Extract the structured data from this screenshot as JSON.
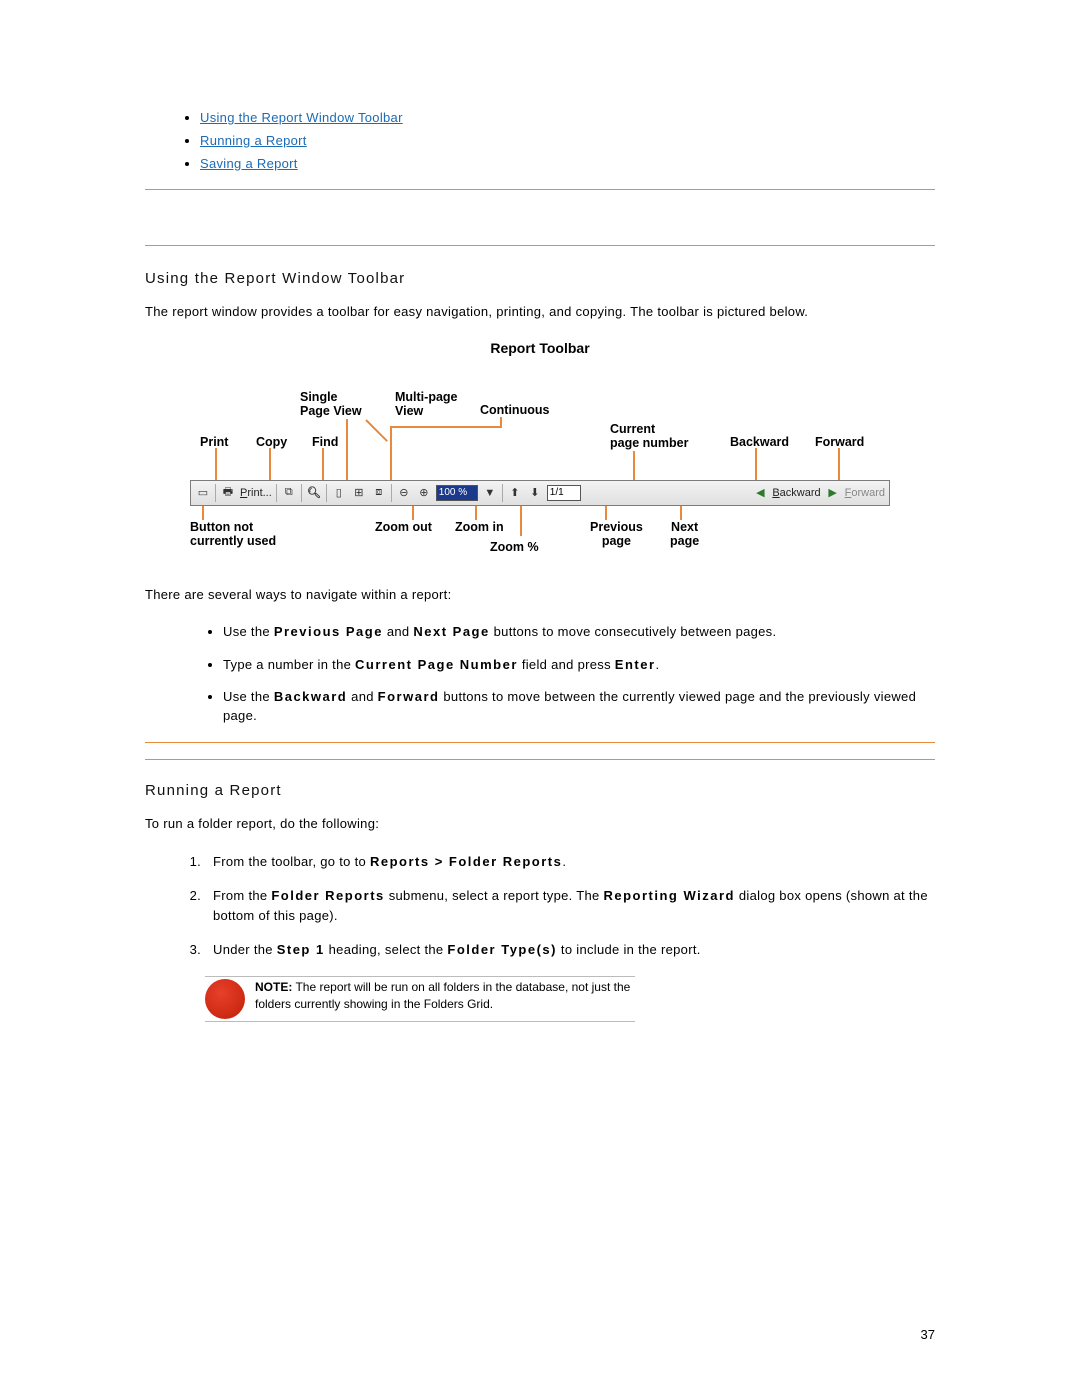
{
  "topLinks": {
    "l1": "Using the Report Window Toolbar",
    "l2": "Running a Report",
    "l3": "Saving a Report"
  },
  "section1": {
    "title": "Using the Report Window Toolbar",
    "intro": "The report window provides a toolbar for easy navigation, printing, and copying. The toolbar is pictured below.",
    "nav_intro": "There are several ways to navigate within a report:",
    "b1_pre": "Use the ",
    "b1_prev": "Previous Page",
    "b1_mid": " and ",
    "b1_next": "Next Page",
    "b1_post": " buttons to move consecutively between pages.",
    "b2_pre": "Type a number in the ",
    "b2_field": "Current Page Number",
    "b2_mid": " field and press ",
    "b2_enter": "Enter",
    "b2_post": ".",
    "b3_pre": "Use the ",
    "b3_back": "Backward",
    "b3_mid": " and ",
    "b3_fwd": "Forward",
    "b3_post": " buttons to move between the currently viewed page and the previously viewed page."
  },
  "figure": {
    "title": "Report Toolbar",
    "labels": {
      "print": "Print",
      "copy": "Copy",
      "find": "Find",
      "single": "Single\nPage View",
      "multi": "Multi-page\nView",
      "continuous": "Continuous",
      "curpage": "Current\npage number",
      "backward": "Backward",
      "forward": "Forward",
      "notused": "Button not\ncurrently used",
      "zoomout": "Zoom out",
      "zoomin": "Zoom in",
      "zoompct": "Zoom %",
      "prevpage": "Previous\npage",
      "nextpage": "Next\npage"
    },
    "toolbar": {
      "printBtn": "Print...",
      "zoomVal": "100 %",
      "pageVal": "1/1",
      "backBtn": "Backward",
      "fwdBtn": "Forward"
    }
  },
  "section2": {
    "title": "Running a Report",
    "intro": "To run a folder report, do the following:",
    "s1_pre": "From the toolbar, go to to ",
    "s1_path": "Reports > Folder Reports",
    "s1_post": ".",
    "s2_pre": "From the ",
    "s2_a": "Folder Reports",
    "s2_mid1": " submenu, select a report type. The ",
    "s2_b": "Reporting Wizard",
    "s2_post": " dialog box opens (shown at the bottom of this page).",
    "s3_pre": "Under the ",
    "s3_a": "Step 1",
    "s3_mid": " heading, select the ",
    "s3_b": "Folder Type(s)",
    "s3_post": " to include in the report."
  },
  "note": {
    "label": "NOTE:",
    "text": " The report will be run on all folders in the database, not just the folders currently showing in the Folders Grid."
  },
  "pageNumber": "37"
}
